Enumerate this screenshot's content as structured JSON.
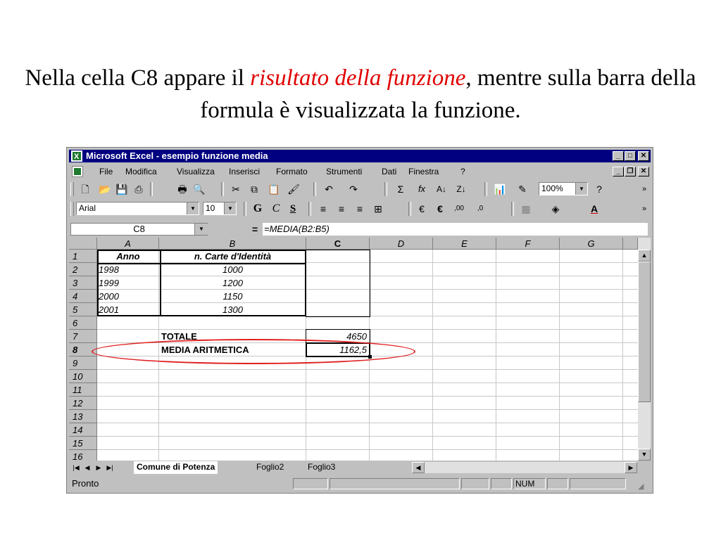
{
  "slide": {
    "title_before": "Nella cella C8 appare il ",
    "title_highlight": "risultato della funzione",
    "title_after": ", mentre sulla barra della formula è visualizzata la funzione.",
    "highlight_color": "#e00000",
    "ellipse_color": "#e02020"
  },
  "window": {
    "title": "Microsoft Excel - esempio funzione media",
    "minimize_label": "_",
    "maximize_label": "□",
    "close_label": "✕",
    "doc_minimize_label": "_",
    "doc_restore_label": "❐",
    "doc_close_label": "✕",
    "title_bar_color": "#000080"
  },
  "menu": {
    "items": [
      "File",
      "Modifica",
      "Visualizza",
      "Inserisci",
      "Formato",
      "Strumenti",
      "Dati",
      "Finestra",
      "?"
    ]
  },
  "toolbar": {
    "standard": {
      "new": "🗋",
      "open": "📂",
      "save": "💾",
      "email": "⎙",
      "print": "🖶",
      "preview": "🔍",
      "cut": "✂",
      "copy": "⧉",
      "paste": "📋",
      "format_painter": "🖌",
      "undo": "↶",
      "redo": "↷",
      "sum": "Σ",
      "function": "fx",
      "sort_asc": "A↓",
      "sort_desc": "Z↓",
      "chart": "📊",
      "drawing": "✎",
      "zoom": "100%",
      "help": "?",
      "more": "»"
    },
    "formatting": {
      "font": "Arial",
      "size": "10",
      "bold": "G",
      "italic": "C",
      "underline": "S",
      "align_left": "≡",
      "align_center": "≡",
      "align_right": "≡",
      "merge": "⊞",
      "currency": "€",
      "euro": "€",
      "increase_decimal": ",00",
      "decrease_decimal": ",0",
      "borders": "▦",
      "fill": "◈",
      "font_color": "A",
      "more": "»"
    }
  },
  "formula_bar": {
    "name_box": "C8",
    "equals": "=",
    "formula": "=MEDIA(B2:B5)"
  },
  "sheet": {
    "columns": [
      "A",
      "B",
      "C",
      "D",
      "E",
      "F",
      "G"
    ],
    "rows": [
      "1",
      "2",
      "3",
      "4",
      "5",
      "6",
      "7",
      "8",
      "9",
      "10",
      "11",
      "12",
      "13",
      "14",
      "15",
      "16"
    ],
    "cells": {
      "A1": "Anno",
      "B1": "n. Carte d'Identità",
      "A2": "1998",
      "B2": "1000",
      "A3": "1999",
      "B3": "1200",
      "A4": "2000",
      "B4": "1150",
      "A5": "2001",
      "B5": "1300",
      "B7": "TOTALE",
      "C7": "4650",
      "B8": "MEDIA ARITMETICA",
      "C8": "1162,5"
    }
  },
  "tabs": {
    "first": "|◀",
    "prev": "◀",
    "next": "▶",
    "last": "▶|",
    "items": [
      "Comune di Potenza",
      "Foglio2",
      "Foglio3"
    ]
  },
  "status": {
    "text": "Pronto",
    "num": "NUM"
  }
}
